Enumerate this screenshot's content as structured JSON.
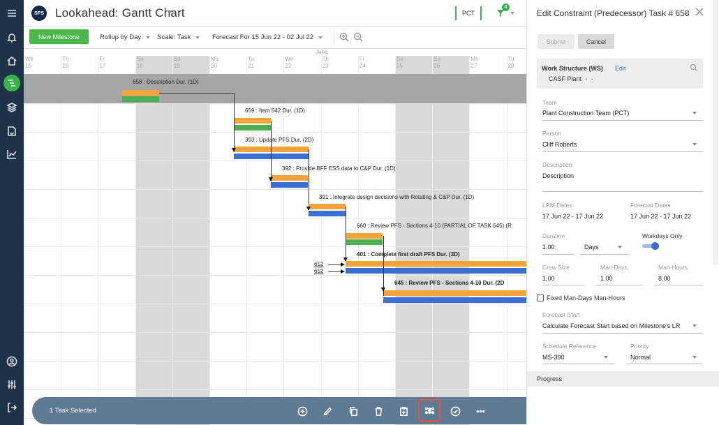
{
  "app": {
    "logo_text": "SPS",
    "title": "Lookahead: Gantt Chart"
  },
  "header": {
    "pct_label": "PCT",
    "filter_count": "4"
  },
  "toolbar": {
    "new_milestone": "New Milestone",
    "rollup": "Rollup by Day",
    "scale": "Scale: Task",
    "forecast": "Forecast For 15 Jun 22 - 02 Jul 22"
  },
  "gantt": {
    "month_label": "June",
    "days": [
      {
        "dow": "We",
        "num": "15"
      },
      {
        "dow": "Th",
        "num": "16"
      },
      {
        "dow": "Fr",
        "num": "17"
      },
      {
        "dow": "Sa",
        "num": "18"
      },
      {
        "dow": "Su",
        "num": "19"
      },
      {
        "dow": "Mo",
        "num": "20"
      },
      {
        "dow": "Tu",
        "num": "21"
      },
      {
        "dow": "We",
        "num": "22"
      },
      {
        "dow": "Th",
        "num": "23"
      },
      {
        "dow": "Fr",
        "num": "24"
      },
      {
        "dow": "Sa",
        "num": "25"
      },
      {
        "dow": "Su",
        "num": "26"
      },
      {
        "dow": "Mo",
        "num": "27"
      },
      {
        "dow": "Tu",
        "num": "28"
      }
    ],
    "tasks": [
      {
        "label": "658 : Description Dur. (1D)"
      },
      {
        "label": "659 : Item 542 Dur. (1D)"
      },
      {
        "label": "393 : Update PFS Dur. (2D)"
      },
      {
        "label": "392 : Provide BFF ESS data to C&P Dur. (1D)"
      },
      {
        "label": "391 : Integrate design decisions with Rotating & C&P Dur. (1D)"
      },
      {
        "label": "660 : Review PFS - Sections 4-10 (PARTIAL OF TASK 645) (R"
      },
      {
        "label": "401 : Complete first draft PFS Dur. (3D)"
      },
      {
        "label": "645 : Review PFS - Sections 4-10 Dur. (2D"
      }
    ],
    "predecessors": [
      "652",
      "652"
    ]
  },
  "bottom_bar": {
    "selected_text": "1 Task Selected"
  },
  "panel": {
    "title": "Edit Constraint (Predecessor) Task # 658",
    "submit": "Submit",
    "cancel": "Cancel",
    "work_structure": {
      "label": "Work Structure (WS)",
      "edit": "Edit",
      "path": "CASF Plant",
      "path_tail": "-"
    },
    "team": {
      "label": "Team",
      "value": "Plant Construction Team (PCT)"
    },
    "person": {
      "label": "Person",
      "value": "Cliff Roberts"
    },
    "description": {
      "label": "Description",
      "value": "Description"
    },
    "lrm_dates": {
      "label": "LRM Dates",
      "value": "17 Jun 22 - 17 Jun 22"
    },
    "forecast_dates": {
      "label": "Forecast Dates",
      "value": "17 Jun 22 - 17 Jun 22"
    },
    "duration": {
      "label": "Duration",
      "value": "1.00",
      "unit": "Days"
    },
    "workdays_only": {
      "label": "Workdays Only",
      "on": true
    },
    "crew_size": {
      "label": "Crew Size",
      "value": "1.00"
    },
    "man_days": {
      "label": "Man-Days",
      "value": "1.00"
    },
    "man_hours": {
      "label": "Man-Hours",
      "value": "8.00"
    },
    "fixed_label": "Fixed Man-Days Man-Hours",
    "forecast_start": {
      "label": "Forecast Start",
      "value": "Calculate Forecast Start based on Milestone's LR"
    },
    "schedule_reference": {
      "label": "Schedule Reference",
      "value": "MS-390"
    },
    "priority": {
      "label": "Priority",
      "value": "Normal"
    },
    "progress": "Progress"
  },
  "colors": {
    "nav_bg": "#1f3247",
    "accent_green": "#4bb74b",
    "bar_orange": "#f5a33b",
    "bar_green": "#4cae4f",
    "bar_blue": "#3b6fd1",
    "bottom_bar": "#5f7a93",
    "highlight": "#e8533b",
    "link_blue": "#3a77c9"
  }
}
